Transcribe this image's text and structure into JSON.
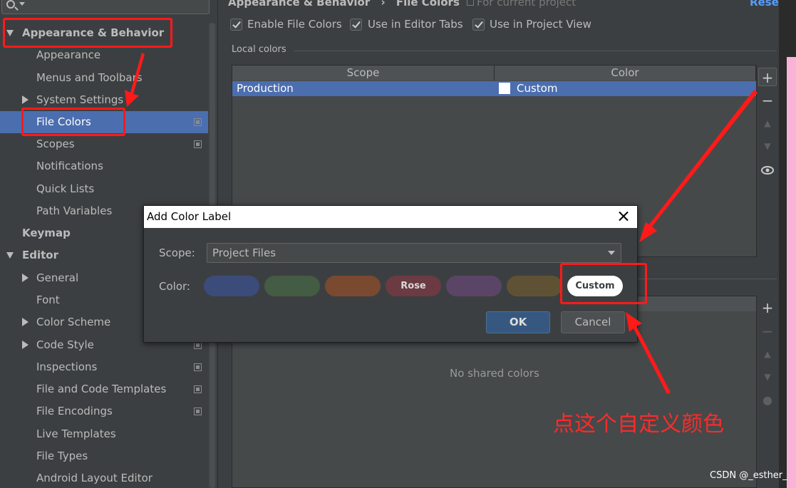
{
  "sidebar": {
    "items": [
      {
        "label": "Appearance & Behavior"
      },
      {
        "label": "Appearance"
      },
      {
        "label": "Menus and Toolbars"
      },
      {
        "label": "System Settings"
      },
      {
        "label": "File Colors"
      },
      {
        "label": "Scopes"
      },
      {
        "label": "Notifications"
      },
      {
        "label": "Quick Lists"
      },
      {
        "label": "Path Variables"
      },
      {
        "label": "Keymap"
      },
      {
        "label": "Editor"
      },
      {
        "label": "General"
      },
      {
        "label": "Font"
      },
      {
        "label": "Color Scheme"
      },
      {
        "label": "Code Style"
      },
      {
        "label": "Inspections"
      },
      {
        "label": "File and Code Templates"
      },
      {
        "label": "File Encodings"
      },
      {
        "label": "Live Templates"
      },
      {
        "label": "File Types"
      },
      {
        "label": "Android Layout Editor"
      }
    ]
  },
  "header": {
    "breadcrumb_parent": "Appearance & Behavior",
    "breadcrumb_sep": "›",
    "breadcrumb_current": "File Colors",
    "scope_note": "For current project",
    "reset": "Reset"
  },
  "options": {
    "enable_file_colors": "Enable File Colors",
    "use_in_editor_tabs": "Use in Editor Tabs",
    "use_in_project_view": "Use in Project View"
  },
  "local_colors": {
    "title": "Local colors",
    "columns": [
      "Scope",
      "Color"
    ],
    "rows": [
      {
        "scope": "Production",
        "color": "Custom"
      }
    ]
  },
  "shared_colors": {
    "empty_text": "No shared colors"
  },
  "dialog": {
    "title": "Add Color Label",
    "scope_label": "Scope:",
    "scope_value": "Project Files",
    "color_label": "Color:",
    "colors": [
      {
        "label": "",
        "hex": "#3b4b7a"
      },
      {
        "label": "",
        "hex": "#445b44"
      },
      {
        "label": "",
        "hex": "#7a4a30"
      },
      {
        "label": "Rose",
        "hex": "#6b3a42"
      },
      {
        "label": "",
        "hex": "#5a4566"
      },
      {
        "label": "",
        "hex": "#5f5234"
      },
      {
        "label": "Custom",
        "hex": "#ffffff"
      }
    ],
    "ok": "OK",
    "cancel": "Cancel"
  },
  "annotation": {
    "text": "点这个自定义颜色"
  },
  "watermark": "CSDN @_esther_",
  "colors": {
    "selection": "#4b6eaf",
    "annotation_red": "#ff1a1a"
  }
}
